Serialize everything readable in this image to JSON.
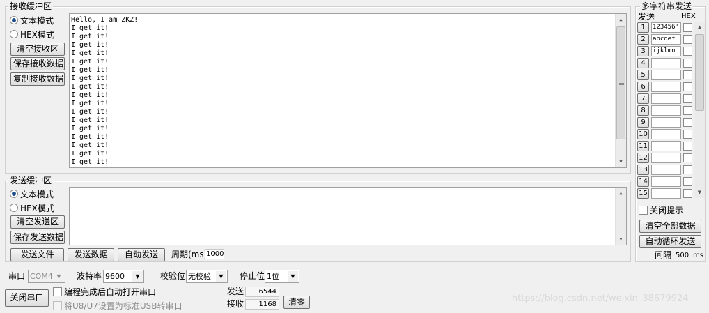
{
  "receive": {
    "title": "接收缓冲区",
    "text_mode": "文本模式",
    "hex_mode": "HEX模式",
    "clear_btn": "清空接收区",
    "save_btn": "保存接收数据",
    "copy_btn": "复制接收数据",
    "lines": [
      "Hello, I am ZKZ!",
      "I get it!",
      "I get it!",
      "I get it!",
      "I get it!",
      "I get it!",
      "I get it!",
      "I get it!",
      "I get it!",
      "I get it!",
      "I get it!",
      "I get it!",
      "I get it!",
      "I get it!",
      "I get it!",
      "I get it!",
      "I get it!",
      "I get it!"
    ]
  },
  "send": {
    "title": "发送缓冲区",
    "text_mode": "文本模式",
    "hex_mode": "HEX模式",
    "clear_btn": "清空发送区",
    "save_btn": "保存发送数据",
    "send_file": "发送文件",
    "send_data": "发送数据",
    "auto_send": "自动发送",
    "period_label": "周期(ms)",
    "period_value": "1000"
  },
  "multi": {
    "title": "多字符串发送",
    "col_send": "发送",
    "col_hex": "HEX",
    "rows": [
      {
        "num": "1",
        "value": "123456'"
      },
      {
        "num": "2",
        "value": "abcdef"
      },
      {
        "num": "3",
        "value": "ijklmn"
      },
      {
        "num": "4",
        "value": ""
      },
      {
        "num": "5",
        "value": ""
      },
      {
        "num": "6",
        "value": ""
      },
      {
        "num": "7",
        "value": ""
      },
      {
        "num": "8",
        "value": ""
      },
      {
        "num": "9",
        "value": ""
      },
      {
        "num": "10",
        "value": ""
      },
      {
        "num": "11",
        "value": ""
      },
      {
        "num": "12",
        "value": ""
      },
      {
        "num": "13",
        "value": ""
      },
      {
        "num": "14",
        "value": ""
      },
      {
        "num": "15",
        "value": ""
      }
    ],
    "close_hint": "关闭提示",
    "clear_all": "清空全部数据",
    "auto_loop": "自动循环发送",
    "interval_label": "间隔",
    "interval_value": "500",
    "interval_unit": "ms"
  },
  "port": {
    "port_label": "串口",
    "port_value": "COM4",
    "baud_label": "波特率",
    "baud_value": "9600",
    "parity_label": "校验位",
    "parity_value": "无校验",
    "stop_label": "停止位",
    "stop_value": "1位",
    "close_btn": "关闭串口",
    "auto_open": "编程完成后自动打开串口",
    "usb_hint": "将U8/U7设置为标准USB转串口",
    "sent_label": "发送",
    "sent_value": "6544",
    "recv_label": "接收",
    "recv_value": "1168",
    "clear_count": "清零"
  },
  "watermark": "https://blog.csdn.net/weixin_38679924"
}
